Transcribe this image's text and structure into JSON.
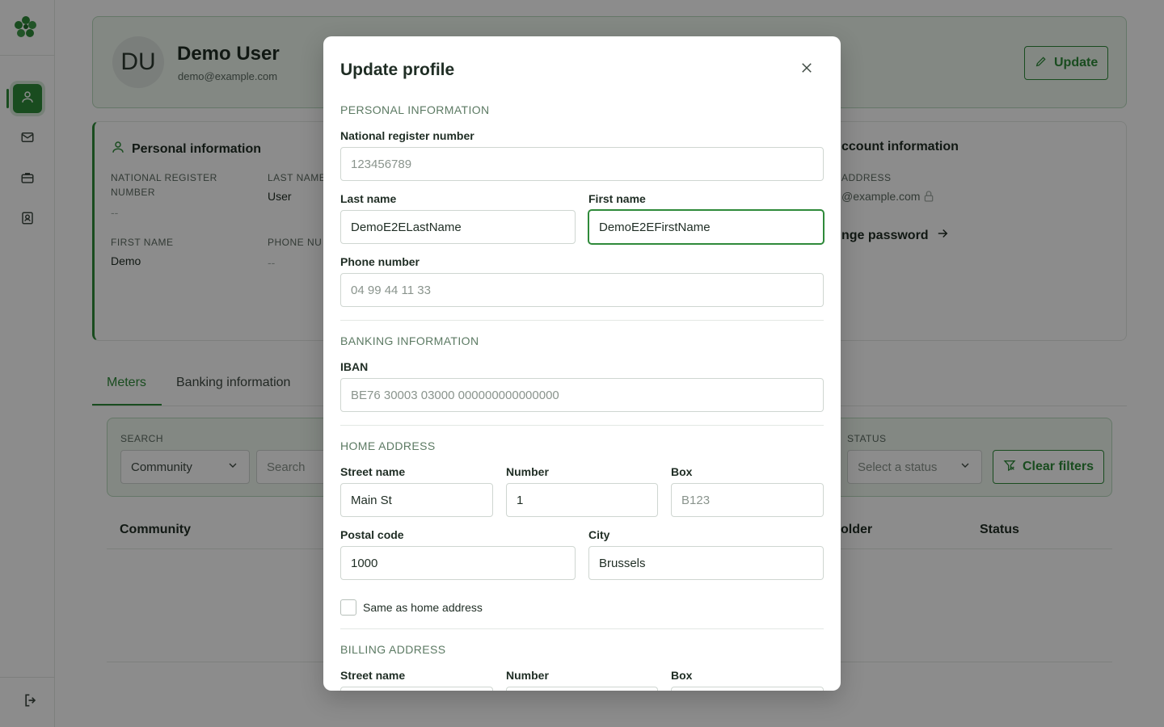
{
  "app": {
    "logo_icon": "clover-logo-icon",
    "accent": "#2f8a3a"
  },
  "sidebar": {
    "items": [
      {
        "icon": "user-icon",
        "active": true
      },
      {
        "icon": "mail-icon",
        "active": false
      },
      {
        "icon": "briefcase-icon",
        "active": false
      },
      {
        "icon": "contact-card-icon",
        "active": false
      }
    ],
    "logout_icon": "logout-icon"
  },
  "profile": {
    "initials": "DU",
    "name": "Demo User",
    "email": "demo@example.com",
    "update_label": "Update"
  },
  "personal_info": {
    "title": "Personal information",
    "national_register_label": "NATIONAL REGISTER NUMBER",
    "national_register_value": "--",
    "last_name_label": "LAST NAME",
    "last_name_value": "User",
    "first_name_label": "FIRST NAME",
    "first_name_value": "Demo",
    "phone_label": "PHONE NU",
    "phone_value": "--"
  },
  "account_info": {
    "title": "ccount information",
    "address_label": "ADDRESS",
    "address_value": "@example.com",
    "change_password": "nge password"
  },
  "tabs": [
    {
      "label": "Meters",
      "active": true
    },
    {
      "label": "Banking information",
      "active": false
    }
  ],
  "filters": {
    "search_label": "SEARCH",
    "search_select": "Community",
    "search_placeholder": "Search",
    "status_label": "STATUS",
    "status_placeholder": "Select a status",
    "clear_label": "Clear filters"
  },
  "table": {
    "columns": [
      "Community",
      "older",
      "Status"
    ]
  },
  "modal": {
    "title": "Update profile",
    "personal_section": "PERSONAL INFORMATION",
    "national_label": "National register number",
    "national_placeholder": "123456789",
    "last_name_label": "Last name",
    "last_name_value": "DemoE2ELastName",
    "first_name_label": "First name",
    "first_name_value": "DemoE2EFirstName",
    "phone_label": "Phone number",
    "phone_placeholder": "04 99 44 11 33",
    "banking_section": "BANKING INFORMATION",
    "iban_label": "IBAN",
    "iban_placeholder": "BE76 30003 03000 000000000000000",
    "home_section": "HOME ADDRESS",
    "street_label": "Street name",
    "street_value": "Main St",
    "number_label": "Number",
    "number_value": "1",
    "box_label": "Box",
    "box_placeholder": "B123",
    "postal_label": "Postal code",
    "postal_value": "1000",
    "city_label": "City",
    "city_value": "Brussels",
    "same_as_home": "Same as home address",
    "billing_section": "BILLING ADDRESS",
    "billing_street_label": "Street name",
    "billing_number_label": "Number",
    "billing_box_label": "Box"
  }
}
